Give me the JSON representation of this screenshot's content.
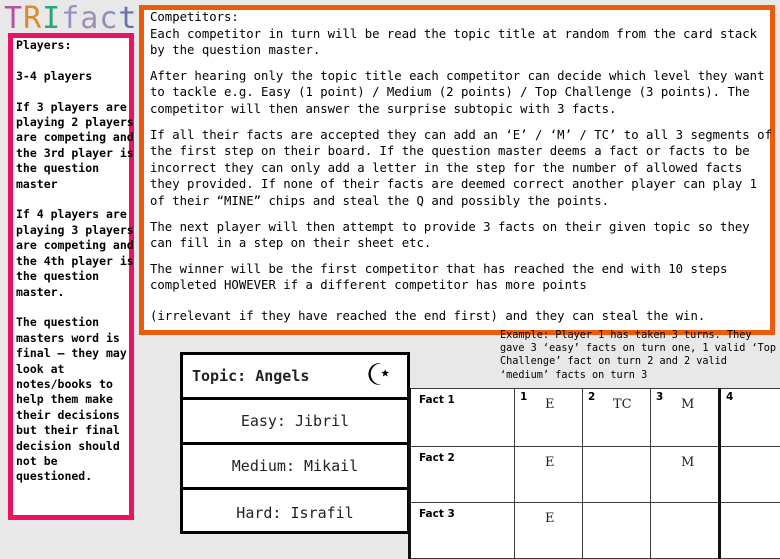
{
  "title": {
    "text": "TRIfact",
    "letters": [
      {
        "ch": "T",
        "color": "#b5539c"
      },
      {
        "ch": "R",
        "color": "#d98c2b"
      },
      {
        "ch": "I",
        "color": "#2aa77a"
      },
      {
        "ch": "f",
        "color": "#9b8fc0"
      },
      {
        "ch": "a",
        "color": "#a08fb8"
      },
      {
        "ch": "c",
        "color": "#8f8fb8"
      },
      {
        "ch": "t",
        "color": "#6b6fb0"
      }
    ]
  },
  "players_panel": {
    "border_color": "#ec1163",
    "text": "Players:\n\n3-4 players\n\nIf 3 players are playing 2 players are competing and the 3rd player is the question master\n\nIf 4 players are playing 3 players are competing and the 4th player is the question master.\n\nThe question masters word is final – they may look at notes/books to help them make their decisions but their final decision should not be questioned."
  },
  "competitors_panel": {
    "border_color": "#ea5b0c",
    "heading": "Competitors:",
    "paragraphs": [
      "Competitors:\nEach competitor in turn will be read the topic title at random from the card stack by the question master.",
      "After hearing only the topic title each competitor can decide which level they want to tackle e.g. Easy (1 point) / Medium (2 points) / Top Challenge (3 points). The competitor will then answer the surprise subtopic with 3 facts.",
      "If all their facts are accepted they can add an ‘E’ / ‘M’ / TC’ to all 3 segments of the first step on their board. If the question master deems a fact or facts to be incorrect they can only add a letter in the step for the number of allowed facts they provided. If none of their facts are deemed correct another player can play 1 of their “MINE” chips and steal the Q and possibly the points.",
      "The next player will then attempt to provide 3 facts on their given topic so they can fill in a step on their sheet etc.",
      "The winner will be the first competitor that has reached the end with 10 steps completed HOWEVER if a different competitor has more points"
    ],
    "overflow_line": "(irrelevant if they have reached the end first) and they can steal the win."
  },
  "example": {
    "text": "Example: Player 1 has taken 3 turns. They gave 3 ‘easy’ facts on turn one, 1 valid ‘Top Challenge’ fact on turn 2 and 2 valid ‘medium’ facts on turn 3"
  },
  "topic_card": {
    "header": "Topic: Angels",
    "icon": "crescent-moon-star-icon",
    "rows": [
      {
        "label": "Easy: Jibril"
      },
      {
        "label": "Medium: Mikail"
      },
      {
        "label": "Hard: Israfil"
      }
    ]
  },
  "fact_table": {
    "row_labels": [
      "Fact 1",
      "Fact 2",
      "Fact 3"
    ],
    "column_numbers": [
      "1",
      "2",
      "3",
      "4"
    ],
    "cells": [
      [
        "E",
        "TC",
        "M",
        ""
      ],
      [
        "E",
        "",
        "M",
        ""
      ],
      [
        "E",
        "",
        "",
        ""
      ]
    ]
  }
}
